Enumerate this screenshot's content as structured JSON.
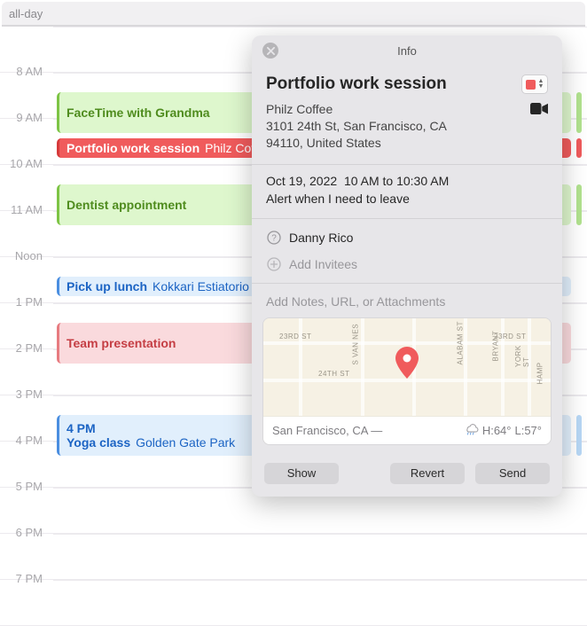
{
  "calendar": {
    "allday_label": "all-day",
    "hours": [
      "8 AM",
      "9 AM",
      "10 AM",
      "11 AM",
      "Noon",
      "1 PM",
      "2 PM",
      "3 PM",
      "4 PM",
      "5 PM",
      "6 PM",
      "7 PM"
    ],
    "events": [
      {
        "title": "FaceTime with Grandma",
        "location": "",
        "start": "9 AM",
        "color": "green"
      },
      {
        "title": "Portfolio work session",
        "location": "Philz Coffee",
        "start": "10 AM",
        "color": "red",
        "selected": true
      },
      {
        "title": "Dentist appointment",
        "location": "",
        "start": "11 AM",
        "color": "green"
      },
      {
        "title": "Pick up lunch",
        "location": "Kokkari Estiatorio",
        "start": "1 PM",
        "color": "blue"
      },
      {
        "title": "Team presentation",
        "location": "",
        "start": "2 PM",
        "color": "pink"
      },
      {
        "time_label": "4 PM",
        "title": "Yoga class",
        "location": "Golden Gate Park",
        "start": "4 PM",
        "color": "blue"
      }
    ]
  },
  "popover": {
    "header_title": "Info",
    "event_title": "Portfolio work session",
    "color": "#f05b5c",
    "location_name": "Philz Coffee",
    "location_addr1": "3101 24th St, San Francisco, CA",
    "location_addr2": "94110, United States",
    "date": "Oct 19, 2022",
    "time": "10 AM to 10:30 AM",
    "alert_text": "Alert when I need to leave",
    "invitee_name": "Danny Rico",
    "add_invitees_label": "Add Invitees",
    "notes_placeholder": "Add Notes, URL, or Attachments",
    "map": {
      "street_labels": [
        "23RD ST",
        "23RD ST",
        "24TH ST",
        "S VAN NES",
        "ALABAM ST",
        "BRYANT",
        "YORK ST",
        "HAMP"
      ],
      "footer_city": "San Francisco, CA —",
      "weather_hi": "H:64°",
      "weather_lo": "L:57°"
    },
    "buttons": {
      "show": "Show",
      "revert": "Revert",
      "send": "Send"
    }
  }
}
